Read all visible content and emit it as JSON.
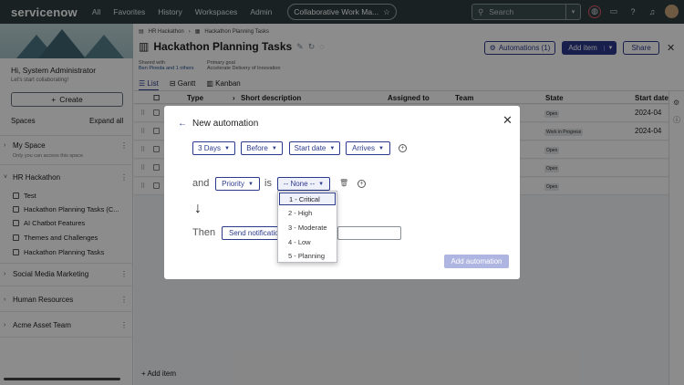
{
  "topnav": {
    "logo": "servicenow",
    "links": [
      "All",
      "Favorites",
      "History",
      "Workspaces",
      "Admin"
    ],
    "workspace_pill": "Collaborative Work Ma...",
    "search_placeholder": "Search"
  },
  "sidebar": {
    "greeting": "Hi, System Administrator",
    "subgreeting": "Let's start collaborating!",
    "create_label": "Create",
    "spaces_label": "Spaces",
    "expand_all_label": "Expand all",
    "my_space": {
      "label": "My Space",
      "note": "Only you can access this space"
    },
    "hr_hackathon": {
      "label": "HR Hackathon",
      "items": [
        "Test",
        "Hackathon Planning Tasks (C...",
        "AI Chatbot Features",
        "Themes and Challenges",
        "Hackathon Planning Tasks"
      ]
    },
    "other_spaces": [
      "Social Media Marketing",
      "Human Resources",
      "Acme Asset Team"
    ]
  },
  "header": {
    "breadcrumb": [
      "HR Hackathon",
      "Hackathon Planning Tasks"
    ],
    "title": "Hackathon Planning Tasks",
    "shared_with_label": "Shared with",
    "shared_with_value": "Ben Pineda and 1 others",
    "primary_goal_label": "Primary goal",
    "primary_goal_value": "Accelerate Delivery of Innovation",
    "automations_label": "Automations (1)",
    "add_item_label": "Add item",
    "share_label": "Share",
    "tabs": [
      "List",
      "Gantt",
      "Kanban"
    ]
  },
  "grid": {
    "columns": [
      "Type",
      "Short description",
      "Assigned to",
      "Team",
      "State",
      "Start date"
    ],
    "rows": [
      {
        "state": "Open",
        "start": "2024-04"
      },
      {
        "state": "Work in Progress",
        "start": "2024-04"
      },
      {
        "state": "Open",
        "start": ""
      },
      {
        "state": "Open",
        "start": ""
      },
      {
        "state": "Open",
        "start": ""
      }
    ],
    "add_item_label": "Add item"
  },
  "modal": {
    "title": "New automation",
    "when": {
      "days": "3 Days",
      "relation": "Before",
      "field": "Start date",
      "event": "Arrives"
    },
    "condition": {
      "and_label": "and",
      "field": "Priority",
      "is_label": "is",
      "value": "-- None --"
    },
    "then_label": "Then",
    "action": "Send notification",
    "submit_label": "Add automation",
    "priority_options": [
      "1 - Critical",
      "2 - High",
      "3 - Moderate",
      "4 - Low",
      "5 - Planning"
    ]
  },
  "colors": {
    "accent": "#2c3a8c",
    "topnav": "#2e3d3e"
  }
}
